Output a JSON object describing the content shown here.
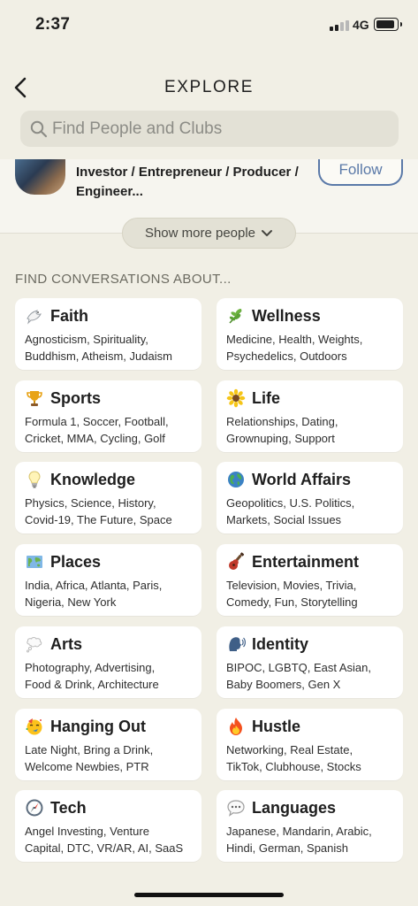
{
  "status": {
    "time": "2:37",
    "network": "4G"
  },
  "header": {
    "title": "EXPLORE"
  },
  "search": {
    "placeholder": "Find People and Clubs"
  },
  "people": {
    "bio_line1": "Investor / Entrepreneur / Producer /",
    "bio_line2": "Engineer...",
    "follow_label": "Follow",
    "show_more_label": "Show more people"
  },
  "conversations": {
    "heading": "FIND CONVERSATIONS ABOUT...",
    "topics": [
      {
        "icon": "dove-icon",
        "name": "Faith",
        "desc1": "Agnosticism, Spirituality,",
        "desc2": "Buddhism, Atheism, Judaism"
      },
      {
        "icon": "herb-icon",
        "name": "Wellness",
        "desc1": "Medicine, Health, Weights,",
        "desc2": "Psychedelics, Outdoors"
      },
      {
        "icon": "trophy-icon",
        "name": "Sports",
        "desc1": "Formula 1, Soccer, Football,",
        "desc2": "Cricket, MMA, Cycling, Golf"
      },
      {
        "icon": "sunflower-icon",
        "name": "Life",
        "desc1": "Relationships, Dating,",
        "desc2": "Grownuping, Support"
      },
      {
        "icon": "lightbulb-icon",
        "name": "Knowledge",
        "desc1": "Physics, Science, History,",
        "desc2": "Covid-19, The Future, Space"
      },
      {
        "icon": "globe-icon",
        "name": "World Affairs",
        "desc1": "Geopolitics, U.S. Politics,",
        "desc2": "Markets, Social Issues"
      },
      {
        "icon": "map-icon",
        "name": "Places",
        "desc1": "India, Africa, Atlanta, Paris,",
        "desc2": "Nigeria, New York"
      },
      {
        "icon": "guitar-icon",
        "name": "Entertainment",
        "desc1": "Television, Movies, Trivia,",
        "desc2": "Comedy, Fun, Storytelling"
      },
      {
        "icon": "thought-bubble-icon",
        "name": "Arts",
        "desc1": "Photography, Advertising,",
        "desc2": "Food & Drink, Architecture"
      },
      {
        "icon": "speaking-head-icon",
        "name": "Identity",
        "desc1": "BIPOC, LGBTQ, East Asian,",
        "desc2": "Baby Boomers, Gen X"
      },
      {
        "icon": "party-face-icon",
        "name": "Hanging Out",
        "desc1": "Late Night, Bring a Drink,",
        "desc2": "Welcome Newbies, PTR"
      },
      {
        "icon": "fire-icon",
        "name": "Hustle",
        "desc1": "Networking, Real Estate,",
        "desc2": "TikTok, Clubhouse, Stocks"
      },
      {
        "icon": "compass-icon",
        "name": "Tech",
        "desc1": "Angel Investing, Venture",
        "desc2": "Capital, DTC, VR/AR, AI, SaaS"
      },
      {
        "icon": "speech-bubble-icon",
        "name": "Languages",
        "desc1": "Japanese, Mandarin, Arabic,",
        "desc2": "Hindi, German, Spanish"
      }
    ]
  },
  "colors": {
    "background": "#f1efe5",
    "card": "#ffffff",
    "accent": "#5a79a8"
  }
}
